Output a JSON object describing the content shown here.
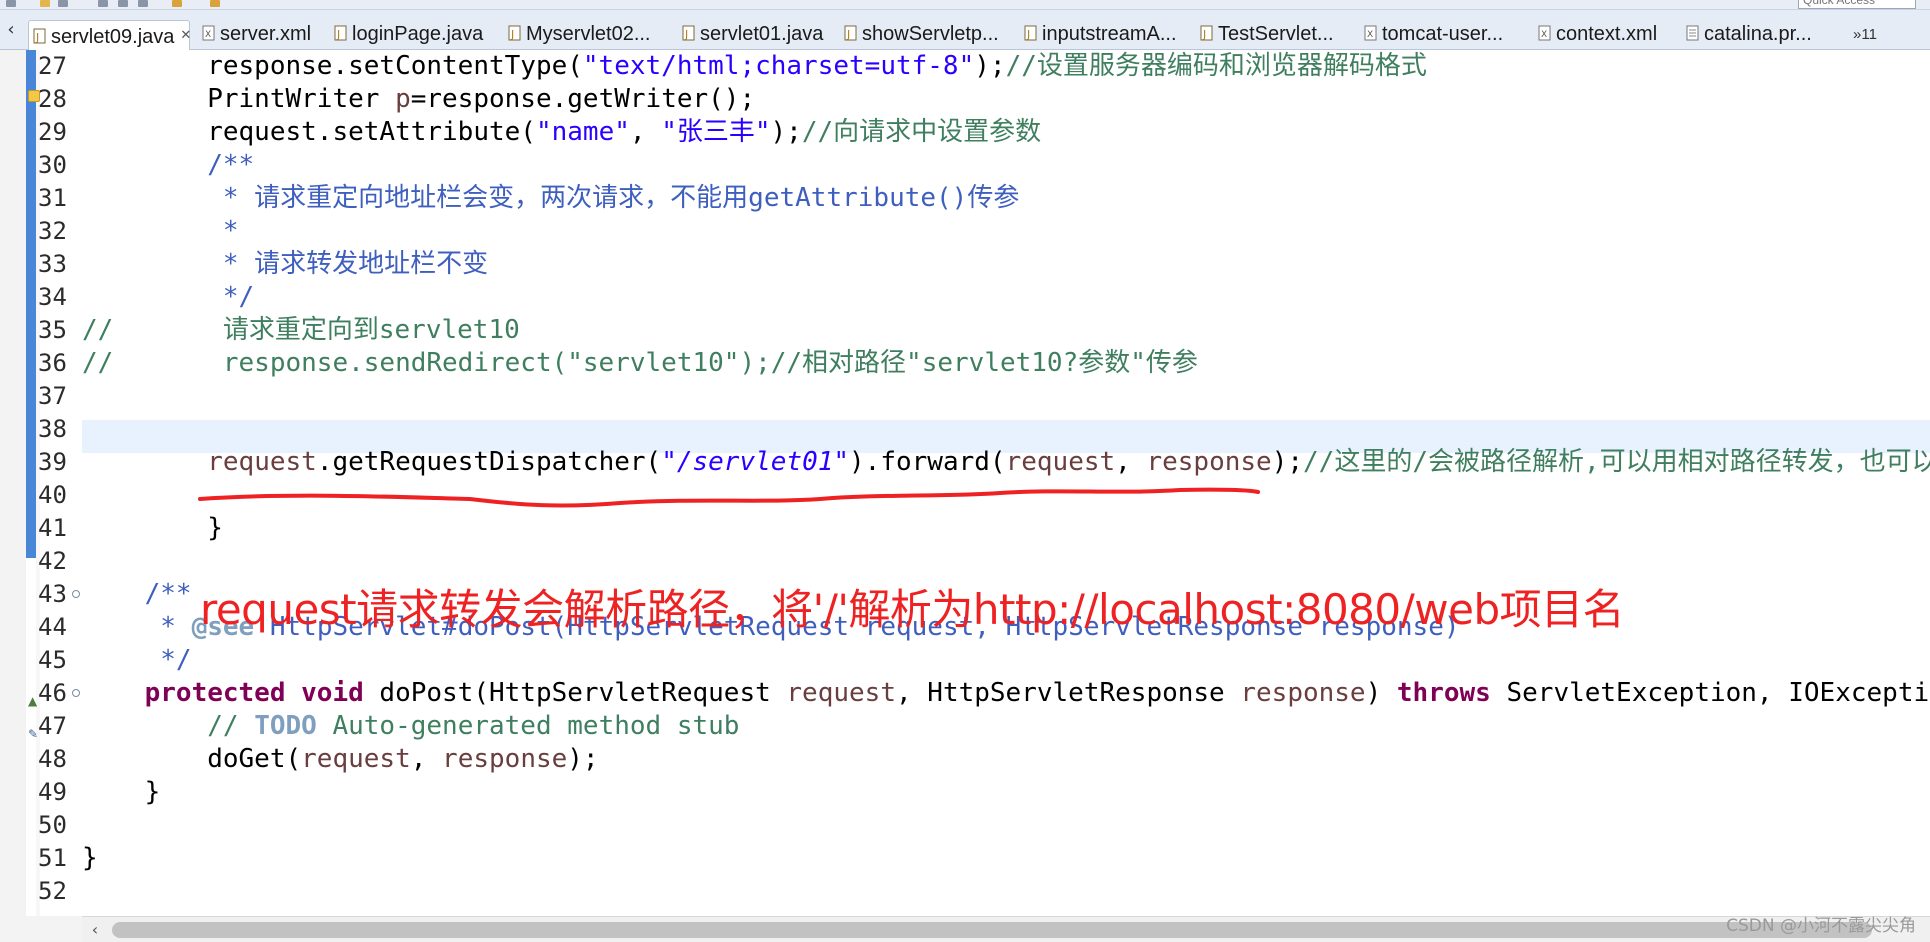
{
  "toolbar": {
    "quick_access": "Quick Access"
  },
  "tabs": [
    {
      "label": "servlet09.java",
      "icon": "java-file-icon",
      "active": true,
      "closable": true
    },
    {
      "label": "server.xml",
      "icon": "xml-file-icon"
    },
    {
      "label": "loginPage.java",
      "icon": "java-file-icon"
    },
    {
      "label": "Myservlet02...",
      "icon": "java-file-icon"
    },
    {
      "label": "servlet01.java",
      "icon": "java-file-icon"
    },
    {
      "label": "showServletp...",
      "icon": "java-file-icon"
    },
    {
      "label": "inputstreamA...",
      "icon": "java-file-icon"
    },
    {
      "label": "TestServlet...",
      "icon": "java-file-icon"
    },
    {
      "label": "tomcat-user...",
      "icon": "xml-file-icon"
    },
    {
      "label": "context.xml",
      "icon": "xml-file-icon"
    },
    {
      "label": "catalina.pr...",
      "icon": "properties-file-icon"
    }
  ],
  "tab_overflow": "»11",
  "code_lines": [
    {
      "num": "27",
      "tokens": [
        [
          "",
          "        response.setContentType("
        ],
        [
          "str",
          "\"text/html;charset=utf-8\""
        ],
        [
          "",
          ");"
        ],
        [
          "cm",
          "//设置服务器编码和浏览器解码格式"
        ]
      ]
    },
    {
      "num": "28",
      "marker": "warning",
      "tokens": [
        [
          "",
          "        PrintWriter "
        ],
        [
          "var",
          "p"
        ],
        [
          "",
          "=response.getWriter();"
        ]
      ]
    },
    {
      "num": "29",
      "tokens": [
        [
          "",
          "        request.setAttribute("
        ],
        [
          "str",
          "\"name\""
        ],
        [
          "",
          ", "
        ],
        [
          "str",
          "\"张三丰\""
        ],
        [
          "",
          ");"
        ],
        [
          "cm",
          "//向请求中设置参数"
        ]
      ]
    },
    {
      "num": "30",
      "tokens": [
        [
          "jd",
          "        /**"
        ]
      ]
    },
    {
      "num": "31",
      "tokens": [
        [
          "jd",
          "         * 请求重定向地址栏会变，两次请求，不能用getAttribute()传参"
        ]
      ]
    },
    {
      "num": "32",
      "tokens": [
        [
          "jd",
          "         *"
        ]
      ]
    },
    {
      "num": "33",
      "tokens": [
        [
          "jd",
          "         * 请求转发地址栏不变"
        ]
      ]
    },
    {
      "num": "34",
      "tokens": [
        [
          "jd",
          "         */"
        ]
      ]
    },
    {
      "num": "35",
      "tokens": [
        [
          "cm",
          "//       请求重定向到servlet10"
        ]
      ]
    },
    {
      "num": "36",
      "tokens": [
        [
          "cm",
          "//       response.sendRedirect(\"servlet10\");//相对路径\"servlet10?参数\"传参"
        ]
      ]
    },
    {
      "num": "37",
      "tokens": []
    },
    {
      "num": "38",
      "tokens": []
    },
    {
      "num": "39",
      "tokens": [
        [
          "",
          "        "
        ],
        [
          "var",
          "request"
        ],
        [
          "",
          ".getRequestDispatcher("
        ],
        [
          "str-it",
          "\"/servlet01\""
        ],
        [
          "",
          ").forward("
        ],
        [
          "var",
          "request"
        ],
        [
          "",
          ", "
        ],
        [
          "var",
          "response"
        ],
        [
          "",
          ");"
        ],
        [
          "cm",
          "//这里的/会被路径解析,可以用相对路径转发，也可以"
        ]
      ]
    },
    {
      "num": "40",
      "tokens": []
    },
    {
      "num": "41",
      "tokens": [
        [
          "",
          "        }"
        ]
      ]
    },
    {
      "num": "42",
      "tokens": []
    },
    {
      "num": "43",
      "fold": true,
      "tokens": [
        [
          "jd",
          "    /**"
        ]
      ]
    },
    {
      "num": "44",
      "tokens": [
        [
          "jd",
          "     * "
        ],
        [
          "jdtag",
          "@see"
        ],
        [
          "jd",
          " HttpServlet#doPost(HttpServletRequest request, HttpServletResponse response)"
        ]
      ]
    },
    {
      "num": "45",
      "tokens": [
        [
          "jd",
          "     */"
        ]
      ]
    },
    {
      "num": "46",
      "fold": true,
      "marker": "override",
      "tokens": [
        [
          "kw",
          "    protected void"
        ],
        [
          "",
          " doPost(HttpServletRequest "
        ],
        [
          "var",
          "request"
        ],
        [
          "",
          ", HttpServletResponse "
        ],
        [
          "var",
          "response"
        ],
        [
          "",
          ") "
        ],
        [
          "kw",
          "throws"
        ],
        [
          "",
          " ServletException, IOException {"
        ]
      ]
    },
    {
      "num": "47",
      "marker": "task",
      "tokens": [
        [
          "cm",
          "        // "
        ],
        [
          "todo",
          "TODO"
        ],
        [
          "cm",
          " Auto-generated method stub"
        ]
      ]
    },
    {
      "num": "48",
      "tokens": [
        [
          "",
          "        doGet("
        ],
        [
          "var",
          "request"
        ],
        [
          "",
          ", "
        ],
        [
          "var",
          "response"
        ],
        [
          "",
          ");"
        ]
      ]
    },
    {
      "num": "49",
      "tokens": [
        [
          "",
          "    }"
        ]
      ]
    },
    {
      "num": "50",
      "tokens": []
    },
    {
      "num": "51",
      "tokens": [
        [
          "",
          "}"
        ]
      ]
    },
    {
      "num": "52",
      "tokens": []
    }
  ],
  "annotation": {
    "text": "request请求转发会解析路径，将'/'解析为http://localhost:8080/web项目名",
    "color": "#ee2222"
  },
  "watermark": "CSDN @小河不露尖尖角",
  "colors": {
    "keyword": "#7f0055",
    "string": "#2a00ff",
    "comment": "#3f7f5f",
    "javadoc": "#3f5fbf",
    "change_bar": "#4a86d8",
    "current_line": "#e8f2fe"
  }
}
